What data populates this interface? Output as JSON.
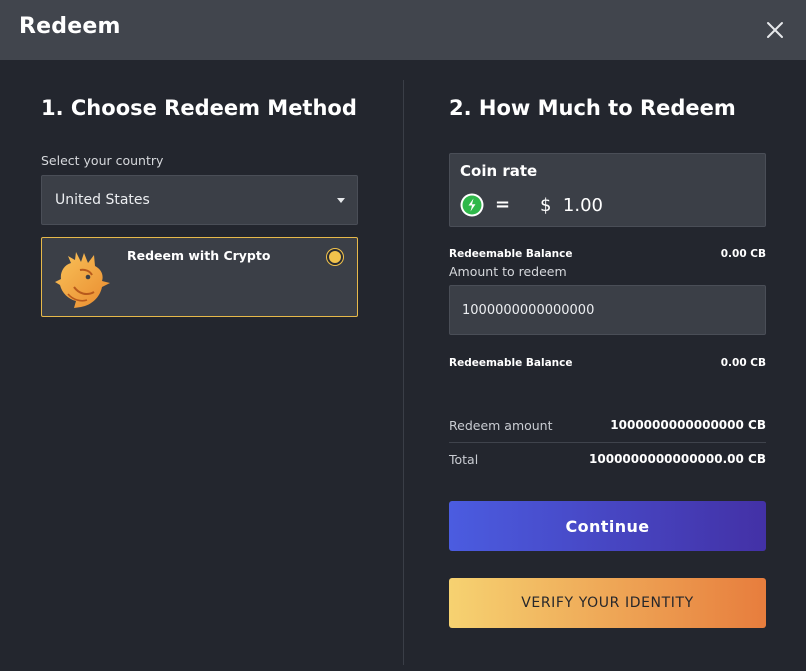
{
  "dialog": {
    "title": "Redeem",
    "close_icon": "close-icon"
  },
  "method_section": {
    "title": "1. Choose Redeem Method",
    "country_label": "Select your country",
    "country_selected": "United States",
    "method": {
      "label": "Redeem with Crypto",
      "logo_icon": "rooster-logo-icon",
      "selected": true
    }
  },
  "amount_section": {
    "title": "2. How Much to Redeem",
    "coin_rate": {
      "title": "Coin rate",
      "coin_icon": "coin-icon",
      "equals": "=",
      "value": "$  1.00"
    },
    "balance_top": {
      "label": "Redeemable Balance",
      "value": "0.00 CB"
    },
    "amount_label": "Amount to redeem",
    "amount_value": "1000000000000000",
    "balance_bottom": {
      "label": "Redeemable Balance",
      "value": "0.00 CB"
    },
    "summary": [
      {
        "label": "Redeem amount",
        "value": "1000000000000000 CB"
      },
      {
        "label": "Total",
        "value": "1000000000000000.00 CB"
      }
    ],
    "continue_label": "Continue",
    "verify_label": "VERIFY YOUR IDENTITY"
  },
  "colors": {
    "background": "#23262e",
    "header": "#41454d",
    "panel": "#3b3f47",
    "accent_gold": "#e7b94a",
    "continue_gradient_start": "#4b5ce0",
    "continue_gradient_end": "#4331a6",
    "verify_gradient_start": "#f6d271",
    "verify_gradient_end": "#e77d3d",
    "coin_green": "#2fb84a"
  }
}
